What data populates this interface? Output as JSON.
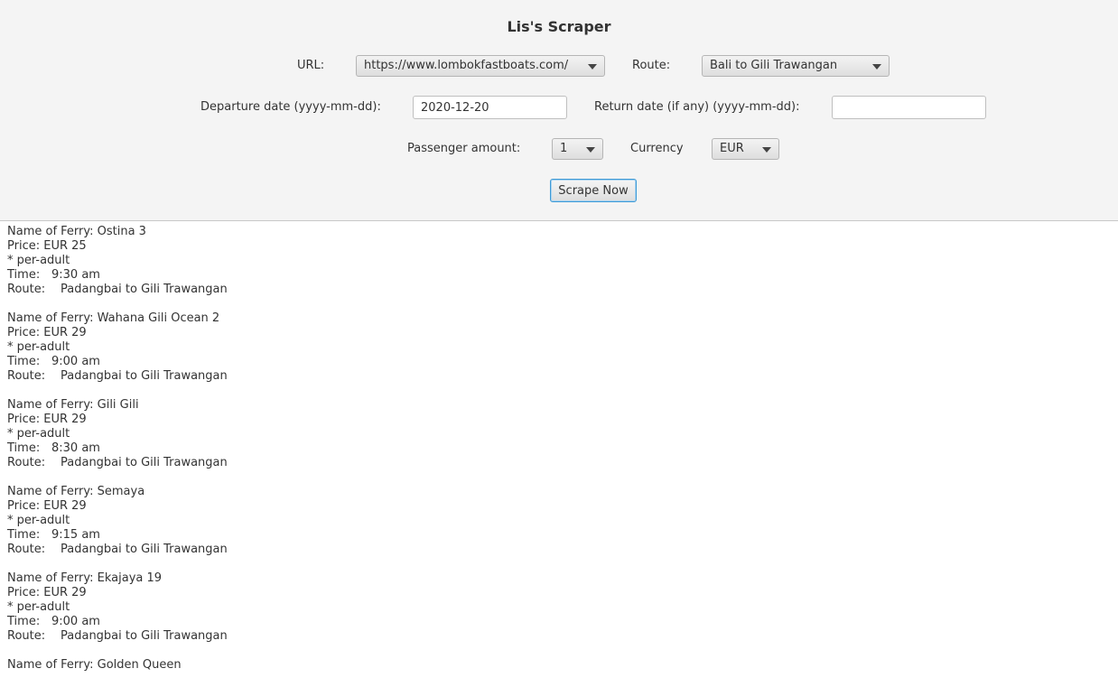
{
  "app": {
    "title": "Lis's Scraper"
  },
  "form": {
    "url_label": "URL:",
    "url_value": "https://www.lombokfastboats.com/",
    "route_label": "Route:",
    "route_value": "Bali to Gili Trawangan",
    "departure_label": "Departure date (yyyy-mm-dd):",
    "departure_value": "2020-12-20",
    "return_label": "Return date (if any) (yyyy-mm-dd):",
    "return_value": "",
    "passenger_label": "Passenger amount:",
    "passenger_value": "1",
    "currency_label": "Currency",
    "currency_value": "EUR",
    "scrape_button": "Scrape Now"
  },
  "results": [
    {
      "name_line": "Name of Ferry: Ostina 3",
      "price_line": "Price: EUR 25",
      "note_line": "* per-adult",
      "time_label": "Time:",
      "time_value": "9:30 am",
      "route_label": "Route:",
      "route_value": "Padangbai to Gili Trawangan"
    },
    {
      "name_line": "Name of Ferry: Wahana Gili Ocean 2",
      "price_line": "Price: EUR 29",
      "note_line": "* per-adult",
      "time_label": "Time:",
      "time_value": "9:00 am",
      "route_label": "Route:",
      "route_value": "Padangbai to Gili Trawangan"
    },
    {
      "name_line": "Name of Ferry: Gili Gili",
      "price_line": "Price: EUR 29",
      "note_line": "* per-adult",
      "time_label": "Time:",
      "time_value": "8:30 am",
      "route_label": "Route:",
      "route_value": "Padangbai to Gili Trawangan"
    },
    {
      "name_line": "Name of Ferry: Semaya",
      "price_line": "Price: EUR 29",
      "note_line": "* per-adult",
      "time_label": "Time:",
      "time_value": "9:15 am",
      "route_label": "Route:",
      "route_value": "Padangbai to Gili Trawangan"
    },
    {
      "name_line": "Name of Ferry: Ekajaya 19",
      "price_line": "Price: EUR 29",
      "note_line": "* per-adult",
      "time_label": "Time:",
      "time_value": "9:00 am",
      "route_label": "Route:",
      "route_value": "Padangbai to Gili Trawangan"
    },
    {
      "name_line": "Name of Ferry: Golden Queen"
    }
  ]
}
